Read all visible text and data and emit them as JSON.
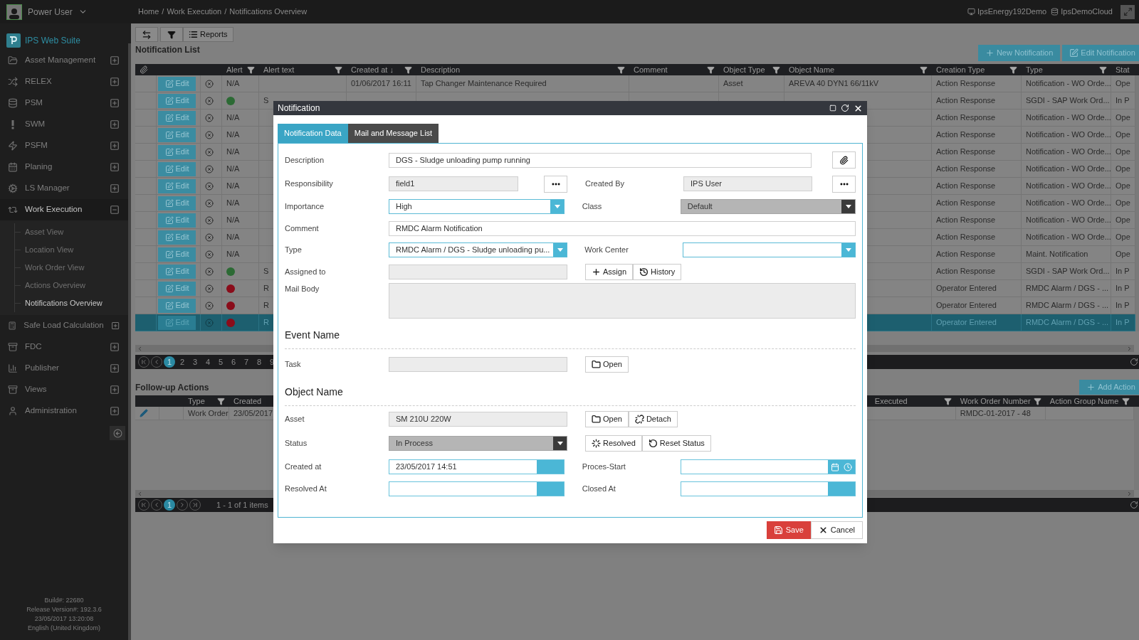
{
  "top_bar": {
    "user": "Power User",
    "breadcrumb": [
      "Home",
      "Work Execution",
      "Notifications Overview"
    ],
    "breadcrumb_separator": "/",
    "server": "IpsEnergy192Demo",
    "database": "IpsDemoCloud"
  },
  "sidebar": {
    "brand": "IPS Web Suite",
    "items": [
      {
        "label": "Asset Management",
        "expanded": false
      },
      {
        "label": "RELEX",
        "expanded": false
      },
      {
        "label": "PSM",
        "expanded": false
      },
      {
        "label": "SWM",
        "expanded": false
      },
      {
        "label": "PSFM",
        "expanded": false
      },
      {
        "label": "Planing",
        "expanded": false
      },
      {
        "label": "LS Manager",
        "expanded": false
      },
      {
        "label": "Work Execution",
        "expanded": true,
        "children": [
          {
            "label": "Asset View",
            "selected": false
          },
          {
            "label": "Location View",
            "selected": false
          },
          {
            "label": "Work Order View",
            "selected": false
          },
          {
            "label": "Actions Overview",
            "selected": false
          },
          {
            "label": "Notifications Overview",
            "selected": true
          }
        ]
      },
      {
        "label": "Safe Load Calculation",
        "expanded": false
      },
      {
        "label": "FDC",
        "expanded": false
      },
      {
        "label": "Publisher",
        "expanded": false
      },
      {
        "label": "Views",
        "expanded": false
      },
      {
        "label": "Administration",
        "expanded": false
      }
    ],
    "footer": [
      "Build#: 22680",
      "Release Version#: 192.3.6",
      "23/05/2017 13:20:08",
      "English (United Kingdom)"
    ]
  },
  "toolbar": {
    "reports": "Reports"
  },
  "notification_list": {
    "title": "Notification List",
    "actions": [
      "New Notification",
      "Edit Notification"
    ],
    "columns": [
      {
        "label": "Alert",
        "filterable": true
      },
      {
        "label": "Alert text",
        "filterable": true
      },
      {
        "label": "Created at ↓",
        "filterable": true
      },
      {
        "label": "Description",
        "filterable": true
      },
      {
        "label": "Comment",
        "filterable": true
      },
      {
        "label": "Object Type",
        "filterable": true
      },
      {
        "label": "Object Name",
        "filterable": true
      },
      {
        "label": "Creation Type",
        "filterable": true
      },
      {
        "label": "Type",
        "filterable": true
      },
      {
        "label": "Stat",
        "filterable": false
      }
    ],
    "rows": [
      {
        "selected": false,
        "edit": "Edit",
        "alert": "N/A",
        "created_at": "01/06/2017 16:11",
        "description": "Tap Changer Maintenance Required",
        "object_type": "Asset",
        "object_name": "AREVA 40 DYN1 66/11kV",
        "creation_type": "Action Response",
        "type": "Notification - WO Orde...",
        "status": "Ope"
      },
      {
        "selected": false,
        "edit": "Edit",
        "color": "#2c6a34",
        "alert_text": "S",
        "creation_type": "Action Response",
        "type": "SGDI - SAP Work Ord...",
        "status": "In P"
      },
      {
        "selected": false,
        "edit": "Edit",
        "alert": "N/A",
        "creation_type": "Action Response",
        "type": "Notification - WO Orde...",
        "status": "Ope"
      },
      {
        "selected": false,
        "edit": "Edit",
        "alert": "N/A",
        "creation_type": "Action Response",
        "type": "Notification - WO Orde...",
        "status": "Ope"
      },
      {
        "selected": false,
        "edit": "Edit",
        "alert": "N/A",
        "creation_type": "Action Response",
        "type": "Notification - WO Orde...",
        "status": "Ope"
      },
      {
        "selected": false,
        "edit": "Edit",
        "alert": "N/A",
        "creation_type": "Action Response",
        "type": "Notification - WO Orde...",
        "status": "Ope"
      },
      {
        "selected": false,
        "edit": "Edit",
        "alert": "N/A",
        "creation_type": "Action Response",
        "type": "Notification - WO Orde...",
        "status": "Ope"
      },
      {
        "selected": false,
        "edit": "Edit",
        "alert": "N/A",
        "creation_type": "Action Response",
        "type": "Notification - WO Orde...",
        "status": "Ope"
      },
      {
        "selected": false,
        "edit": "Edit",
        "alert": "N/A",
        "creation_type": "Action Response",
        "type": "Notification - WO Orde...",
        "status": "Ope"
      },
      {
        "selected": false,
        "edit": "Edit",
        "alert": "N/A",
        "creation_type": "Action Response",
        "type": "Notification - WO Orde...",
        "status": "Ope"
      },
      {
        "selected": false,
        "edit": "Edit",
        "alert": "N/A",
        "creation_type": "Action Response",
        "type": "Maint. Notification",
        "status": "Ope"
      },
      {
        "selected": false,
        "edit": "Edit",
        "color": "#2c6a34",
        "alert_text": "S",
        "creation_type": "Action Response",
        "type": "SGDI - SAP Work Ord...",
        "status": "In P"
      },
      {
        "selected": false,
        "edit": "Edit",
        "color": "#8a0c1a",
        "alert_text": "R",
        "creation_type": "Operator Entered",
        "type": "RMDC Alarm / DGS - ...",
        "status": "In P"
      },
      {
        "selected": false,
        "edit": "Edit",
        "color": "#8a0c1a",
        "alert_text": "R",
        "creation_type": "Operator Entered",
        "type": "RMDC Alarm / DGS - ...",
        "status": "In P"
      },
      {
        "selected": true,
        "edit": "Edit",
        "color": "#8a0c1a",
        "alert_text": "R",
        "creation_type": "Operator Entered",
        "type": "RMDC Alarm / DGS - ...",
        "status": "In P"
      }
    ],
    "pages": [
      {
        "label": "1",
        "selected": true
      },
      {
        "label": "2",
        "selected": false
      },
      {
        "label": "3",
        "selected": false
      },
      {
        "label": "4",
        "selected": false
      },
      {
        "label": "5",
        "selected": false
      },
      {
        "label": "6",
        "selected": false
      },
      {
        "label": "7",
        "selected": false
      },
      {
        "label": "8",
        "selected": false
      },
      {
        "label": "9",
        "selected": false
      }
    ]
  },
  "follow_up": {
    "title": "Follow-up Actions",
    "action": "Add Action",
    "left_columns": [
      {
        "label": "Type",
        "filterable": true
      },
      {
        "label": "Created",
        "filterable": false
      }
    ],
    "right_columns": [
      {
        "label": "Executed",
        "filterable": true
      },
      {
        "label": "Work Order Number",
        "filterable": true
      },
      {
        "label": "Action Group Name",
        "filterable": true
      }
    ],
    "rows": [
      {
        "type": "Work Order",
        "created": "23/05/2017",
        "work_order_number": "RMDC-01-2017 - 48"
      }
    ],
    "pages": [
      {
        "label": "1",
        "selected": true
      }
    ],
    "summary": "1 - 1 of 1 items"
  },
  "dialog": {
    "title": "Notification",
    "tabs": [
      {
        "label": "Notification Data",
        "selected": true
      },
      {
        "label": "Mail and Message List",
        "selected": false
      }
    ],
    "description": {
      "label": "Description",
      "value": "DGS - Sludge unloading pump running"
    },
    "responsibility": {
      "label": "Responsibility",
      "value": "field1"
    },
    "created_by": {
      "label": "Created By",
      "value": "IPS User"
    },
    "importance": {
      "label": "Importance",
      "value": "High",
      "disabled": false
    },
    "class": {
      "label": "Class",
      "value": "Default",
      "disabled": true
    },
    "comment": {
      "label": "Comment",
      "value": "RMDC Alarm Notification"
    },
    "type": {
      "label": "Type",
      "value": "RMDC Alarm / DGS - Sludge unloading pu...",
      "disabled": false
    },
    "work_center": {
      "label": "Work Center",
      "disabled": false
    },
    "assigned_to": {
      "label": "Assigned to"
    },
    "assign_button": "Assign",
    "history_button": "History",
    "mail_body": {
      "label": "Mail Body"
    },
    "event_section": "Event Name",
    "task": {
      "label": "Task"
    },
    "task_open": "Open",
    "object_section": "Object Name",
    "asset": {
      "label": "Asset",
      "value": "SM 210U 220W"
    },
    "asset_open": "Open",
    "detach": "Detach",
    "status": {
      "label": "Status",
      "value": "In Process",
      "disabled": true
    },
    "resolved_button": "Resolved",
    "reset_button": "Reset Status",
    "created_at": {
      "label": "Created at",
      "value": "23/05/2017 14:51"
    },
    "proces_start": {
      "label": "Proces-Start"
    },
    "resolved_at": {
      "label": "Resolved At"
    },
    "closed_at": {
      "label": "Closed At"
    },
    "save": "Save",
    "cancel": "Cancel"
  }
}
